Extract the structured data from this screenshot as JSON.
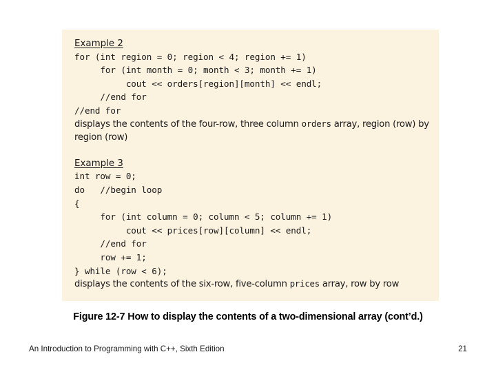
{
  "slide": {
    "panel_background": "#fcf2e0",
    "page_background": "#ffffff",
    "text_color": "#1a1a1a"
  },
  "figure": {
    "example2": {
      "heading": "Example 2",
      "code_lines": [
        "for (int region = 0; region < 4; region += 1)",
        "     for (int month = 0; month < 3; month += 1)",
        "          cout << orders[region][month] << endl;",
        "     //end for",
        "//end for"
      ],
      "description_pre": "displays the contents of the four-row, three column ",
      "description_mono": "orders",
      "description_post": " array, region (row) by region (row)"
    },
    "example3": {
      "heading": "Example 3",
      "code_lines": [
        "int row = 0;",
        "do   //begin loop",
        "{",
        "     for (int column = 0; column < 5; column += 1)",
        "          cout << prices[row][column] << endl;",
        "     //end for",
        "     row += 1;",
        "} while (row < 6);"
      ],
      "description_pre": "displays the contents of the six-row, five-column ",
      "description_mono": "prices",
      "description_post": " array, row by row"
    }
  },
  "caption": {
    "text": "Figure 12-7 How to display the contents of a two-dimensional array (cont’d.)"
  },
  "footer": {
    "book_title": "An Introduction to Programming with C++, Sixth Edition",
    "page_number": "21"
  }
}
